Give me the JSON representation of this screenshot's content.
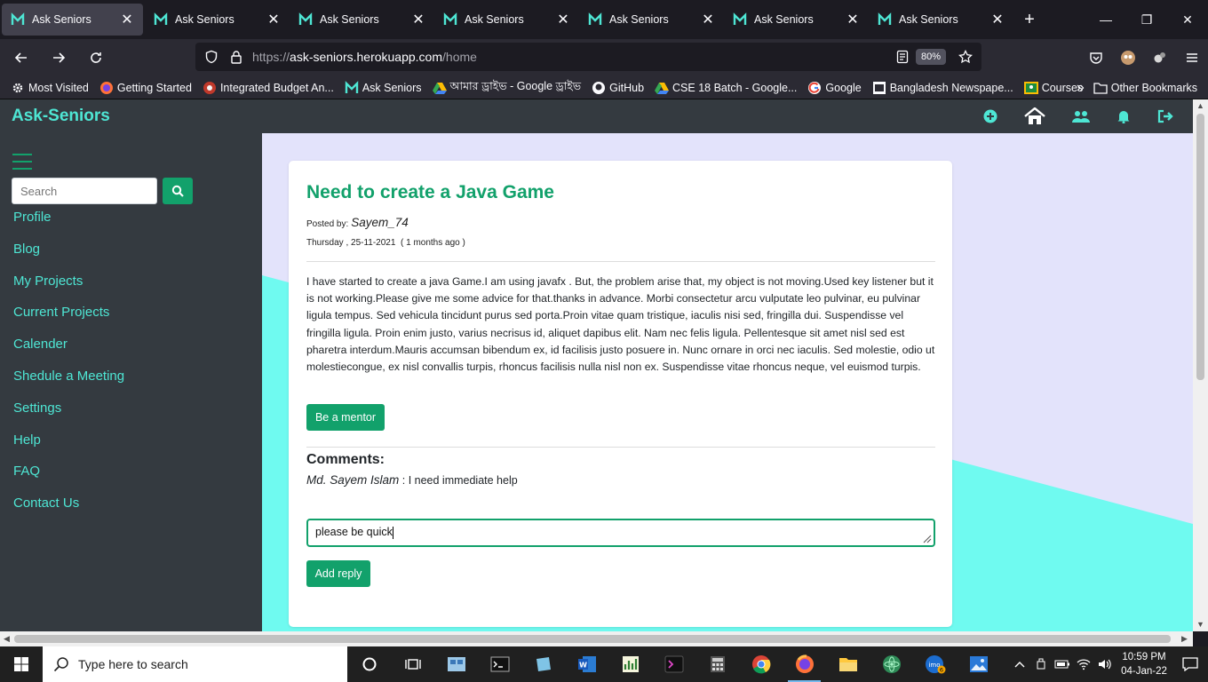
{
  "browser": {
    "tabs": [
      {
        "title": "Ask Seniors"
      },
      {
        "title": "Ask Seniors"
      },
      {
        "title": "Ask Seniors"
      },
      {
        "title": "Ask Seniors"
      },
      {
        "title": "Ask Seniors"
      },
      {
        "title": "Ask Seniors"
      },
      {
        "title": "Ask Seniors"
      }
    ],
    "url_prefix": "https://",
    "url_host": "ask-seniors.herokuapp.com",
    "url_path": "/home",
    "zoom": "80%",
    "bookmarks": [
      {
        "label": "Most Visited",
        "icon": "gear-icon"
      },
      {
        "label": "Getting Started",
        "icon": "firefox-icon"
      },
      {
        "label": "Integrated Budget An...",
        "icon": "budget-icon"
      },
      {
        "label": "Ask Seniors",
        "icon": "ask-seniors-icon"
      },
      {
        "label": "আমার ড্রাইভ - Google ড্রাইভ",
        "icon": "google-drive-icon"
      },
      {
        "label": "GitHub",
        "icon": "github-icon"
      },
      {
        "label": "CSE 18 Batch - Google...",
        "icon": "google-drive-icon"
      },
      {
        "label": "Google",
        "icon": "google-icon"
      },
      {
        "label": "Bangladesh Newspape...",
        "icon": "newspaper-icon"
      },
      {
        "label": "Courses",
        "icon": "classroom-icon"
      }
    ],
    "other_bookmarks": "Other Bookmarks"
  },
  "app": {
    "brand": "Ask-Seniors",
    "search_placeholder": "Search",
    "menu": [
      "Profile",
      "Blog",
      "My Projects",
      "Current Projects",
      "Calender",
      "Shedule a Meeting",
      "Settings",
      "Help",
      "FAQ",
      "Contact Us"
    ]
  },
  "post": {
    "title": "Need to create a Java Game",
    "posted_by_label": "Posted by:",
    "author": "Sayem_74",
    "date": "Thursday , 25-11-2021",
    "ago": "( 1 months ago )",
    "body": "I have started to create a java Game.I am using javafx . But, the problem arise that, my object is not moving.Used key listener but it is not working.Please give me some advice for that.thanks in advance. Morbi consectetur arcu vulputate leo pulvinar, eu pulvinar ligula tempus. Sed vehicula tincidunt purus sed porta.Proin vitae quam tristique, iaculis nisi sed, fringilla dui. Suspendisse vel fringilla ligula. Proin enim justo, varius necrisus id, aliquet dapibus elit. Nam nec felis ligula. Pellentesque sit amet nisl sed est pharetra interdum.Mauris accumsan bibendum ex, id facilisis justo posuere in. Nunc ornare in orci nec iaculis. Sed molestie, odio ut molestiecongue, ex nisl convallis turpis, rhoncus facilisis nulla nisl non ex. Suspendisse vitae rhoncus neque, vel euismod turpis.",
    "mentor_button": "Be a mentor",
    "comments_heading": "Comments:",
    "comments": [
      {
        "author": "Md. Sayem Islam",
        "text": " : I need immediate help"
      }
    ],
    "reply_value": "please be quick",
    "reply_button": "Add reply"
  },
  "taskbar": {
    "search_placeholder": "Type here to search",
    "time": "10:59 PM",
    "date": "04-Jan-22",
    "imo_badge": "6"
  },
  "colors": {
    "accent": "#12a16b",
    "brand": "#4ee6d4",
    "sidebar": "#343a40",
    "page_bg": "#e3e3fb",
    "page_diagonal": "#6ffaf0"
  }
}
